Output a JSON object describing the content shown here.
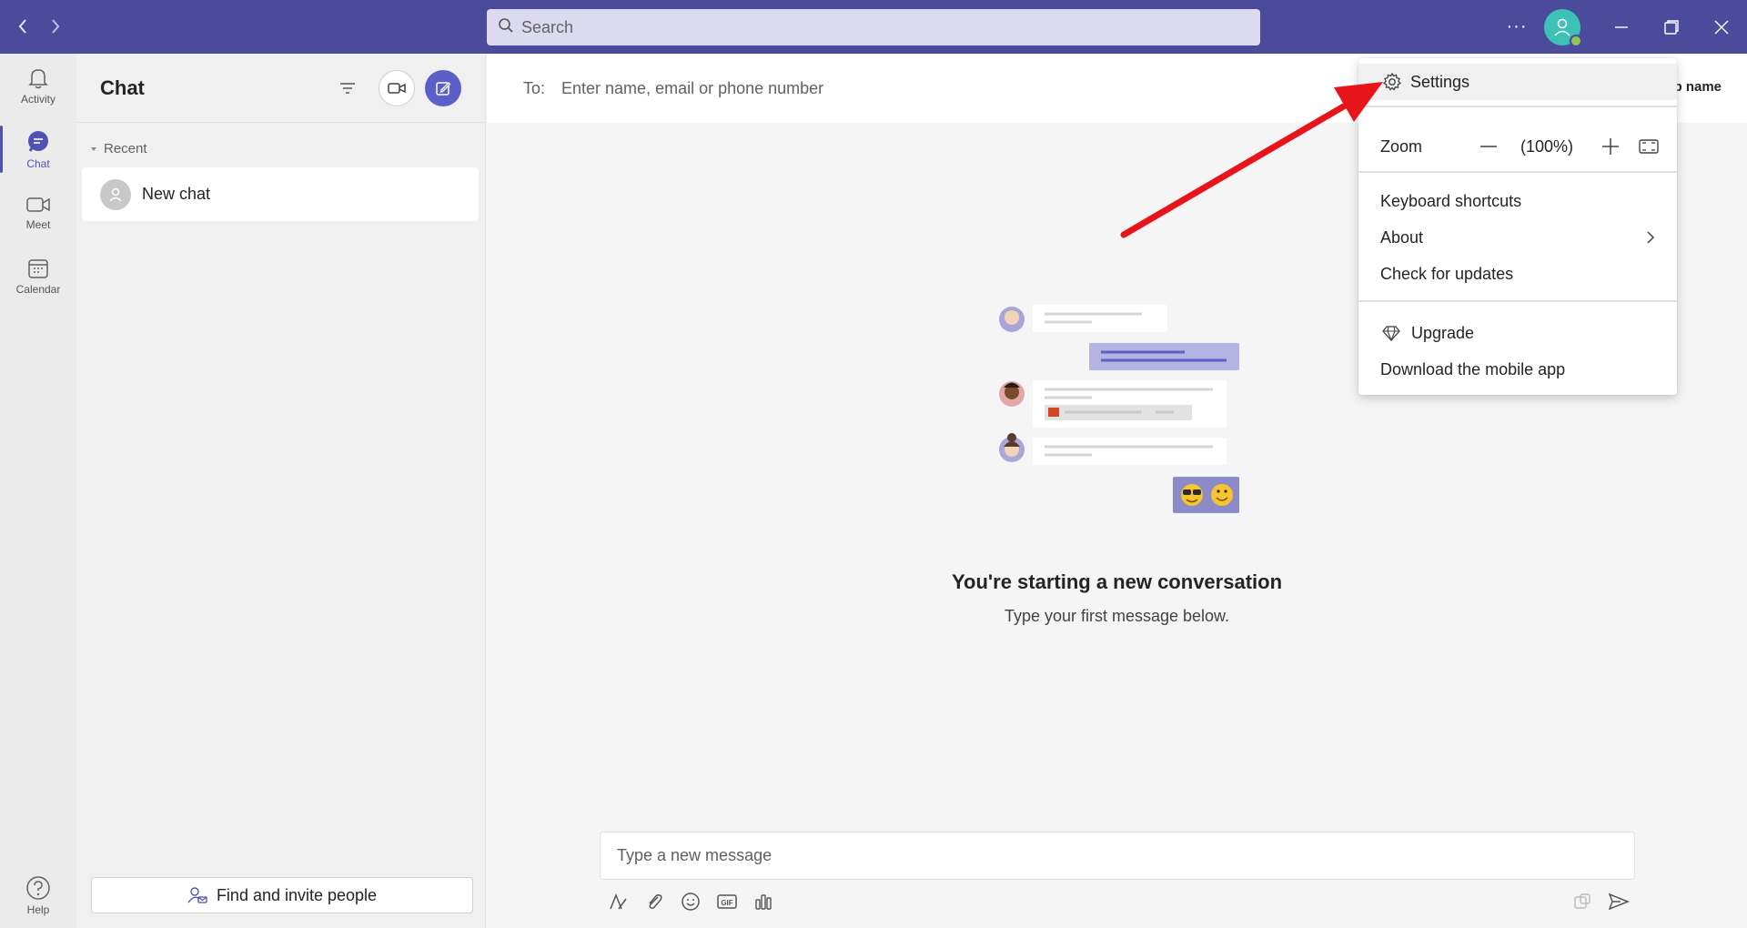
{
  "titlebar": {
    "search_placeholder": "Search",
    "more_label": "···"
  },
  "rail": {
    "items": [
      {
        "label": "Activity",
        "icon": "bell-icon"
      },
      {
        "label": "Chat",
        "icon": "chat-icon"
      },
      {
        "label": "Meet",
        "icon": "video-icon"
      },
      {
        "label": "Calendar",
        "icon": "calendar-icon"
      }
    ],
    "help_label": "Help"
  },
  "chat_pane": {
    "title": "Chat",
    "recent_label": "Recent",
    "chats": [
      {
        "name": "New chat"
      }
    ],
    "find_people_label": "Find and invite people"
  },
  "main": {
    "to_label": "To:",
    "to_placeholder": "Enter name, email or phone number",
    "group_name_partial": "p name",
    "conversation_title": "You're starting a new conversation",
    "conversation_subtitle": "Type your first message below.",
    "compose_placeholder": "Type a new message"
  },
  "menu": {
    "settings": "Settings",
    "zoom_label": "Zoom",
    "zoom_value": "(100%)",
    "keyboard_shortcuts": "Keyboard shortcuts",
    "about": "About",
    "check_updates": "Check for updates",
    "upgrade": "Upgrade",
    "download_app": "Download the mobile app"
  },
  "colors": {
    "titlebar": "#4b4b9c",
    "accent": "#4f52b2",
    "avatar": "#3ec2b8",
    "annotation_arrow": "#e8141b"
  }
}
